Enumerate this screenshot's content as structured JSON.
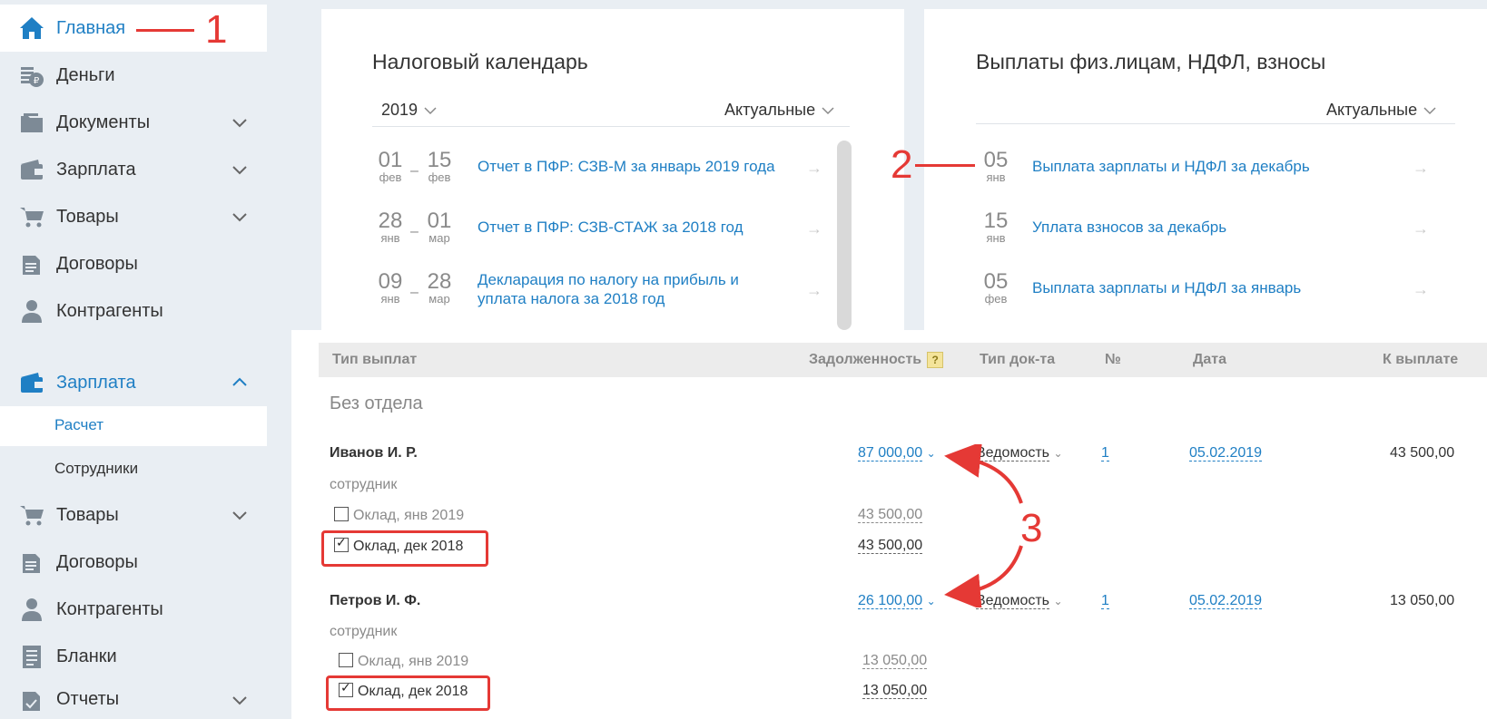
{
  "sidebar_top": {
    "items": [
      {
        "label": "Главная",
        "icon": "home-icon",
        "active": true
      },
      {
        "label": "Деньги",
        "icon": "money-icon"
      },
      {
        "label": "Документы",
        "icon": "folder-icon",
        "expandable": true
      },
      {
        "label": "Зарплата",
        "icon": "wallet-icon",
        "expandable": true
      },
      {
        "label": "Товары",
        "icon": "cart-icon",
        "expandable": true
      },
      {
        "label": "Договоры",
        "icon": "document-icon"
      },
      {
        "label": "Контрагенты",
        "icon": "person-icon"
      }
    ]
  },
  "sidebar_bottom": {
    "section": {
      "label": "Зарплата",
      "icon": "wallet-icon"
    },
    "sub": [
      {
        "label": "Расчет",
        "active": true
      },
      {
        "label": "Сотрудники"
      }
    ],
    "items": [
      {
        "label": "Товары",
        "icon": "cart-icon",
        "expandable": true
      },
      {
        "label": "Договоры",
        "icon": "document-icon"
      },
      {
        "label": "Контрагенты",
        "icon": "person-icon"
      },
      {
        "label": "Бланки",
        "icon": "forms-icon"
      },
      {
        "label": "Отчеты",
        "icon": "reports-icon",
        "expandable": true
      }
    ]
  },
  "tax_calendar": {
    "title": "Налоговый календарь",
    "year": "2019",
    "filter": "Актуальные",
    "events": [
      {
        "d1": "01",
        "m1": "фев",
        "d2": "15",
        "m2": "фев",
        "text": "Отчет в ПФР: СЗВ-М за январь 2019 года"
      },
      {
        "d1": "28",
        "m1": "янв",
        "d2": "01",
        "m2": "мар",
        "text": "Отчет в ПФР: СЗВ-СТАЖ за 2018 год"
      },
      {
        "d1": "09",
        "m1": "янв",
        "d2": "28",
        "m2": "мар",
        "text": "Декларация по налогу на прибыль и уплата налога за 2018 год"
      }
    ]
  },
  "payments": {
    "title": "Выплаты физ.лицам, НДФЛ, взносы",
    "filter": "Актуальные",
    "events": [
      {
        "d": "05",
        "m": "янв",
        "text": "Выплата зарплаты и НДФЛ за декабрь"
      },
      {
        "d": "15",
        "m": "янв",
        "text": "Уплата взносов за декабрь"
      },
      {
        "d": "05",
        "m": "фев",
        "text": "Выплата зарплаты и НДФЛ за январь"
      }
    ]
  },
  "table": {
    "headers": {
      "type": "Тип выплат",
      "debt": "Задолженность",
      "help": "?",
      "doc_type": "Тип док-та",
      "num": "№",
      "date": "Дата",
      "to_pay": "К выплате"
    },
    "group": "Без отдела",
    "rows": [
      {
        "name": "Иванов И. Р.",
        "role": "сотрудник",
        "debt": "87 000,00",
        "doc_type": "Ведомость",
        "num": "1",
        "date": "05.02.2019",
        "to_pay": "43 500,00",
        "items": [
          {
            "label": "Оклад, янв 2019",
            "amount": "43 500,00",
            "checked": false
          },
          {
            "label": "Оклад, дек 2018",
            "amount": "43 500,00",
            "checked": true
          }
        ]
      },
      {
        "name": "Петров И. Ф.",
        "role": "сотрудник",
        "debt": "26 100,00",
        "doc_type": "Ведомость",
        "num": "1",
        "date": "05.02.2019",
        "to_pay": "13 050,00",
        "items": [
          {
            "label": "Оклад, янв 2019",
            "amount": "13 050,00",
            "checked": false
          },
          {
            "label": "Оклад, дек 2018",
            "amount": "13 050,00",
            "checked": true
          }
        ]
      }
    ]
  },
  "annotations": {
    "n1": "1",
    "n2": "2",
    "n3": "3",
    "color": "#e53935"
  },
  "colors": {
    "accent": "#1f7fc4",
    "sidebar_bg": "#e9eef3",
    "icon": "#7d8a96",
    "active_icon": "#1f7fc4"
  }
}
